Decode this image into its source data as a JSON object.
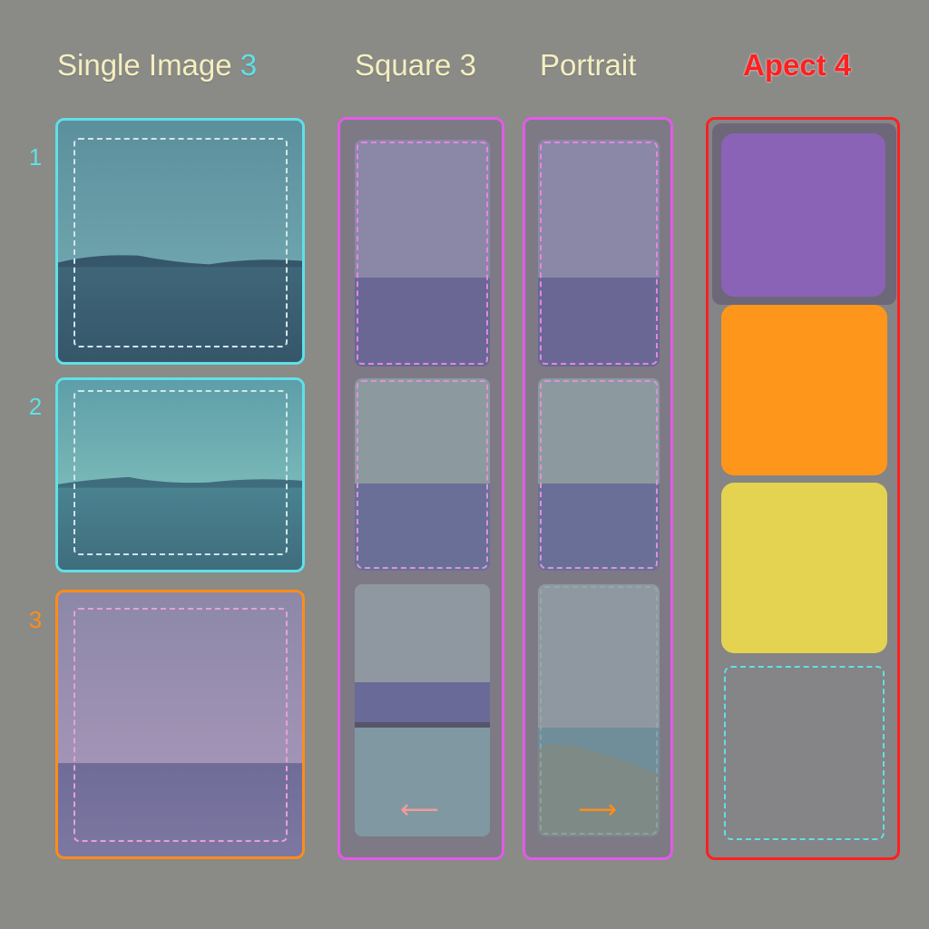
{
  "columns": {
    "single": {
      "label": "Single Image",
      "count": "3",
      "accent": "#5fe0e8"
    },
    "square": {
      "label": "Square 3"
    },
    "portrait": {
      "label": "Portrait"
    },
    "aspect": {
      "label": "Apect 4",
      "color": "#ff2020"
    }
  },
  "rows": [
    {
      "number": "1",
      "color": "#5fe0e8"
    },
    {
      "number": "2",
      "color": "#5fe0e8"
    },
    {
      "number": "3",
      "color": "#ff8c1a"
    }
  ],
  "arrows": {
    "square": {
      "glyph": "⟵",
      "color": "#f29a9a"
    },
    "portrait": {
      "glyph": "⟶",
      "color": "#ff8c1a"
    }
  },
  "colors": {
    "background": "#8a8a86",
    "cyan_frame": "#5fe0e8",
    "orange_frame": "#ff8c1a",
    "magenta_frame": "#e25ae8",
    "red_frame": "#ff2020",
    "purple_block": "#8b63b6",
    "orange_block": "#ff961c",
    "yellow_block": "#e3d351"
  }
}
